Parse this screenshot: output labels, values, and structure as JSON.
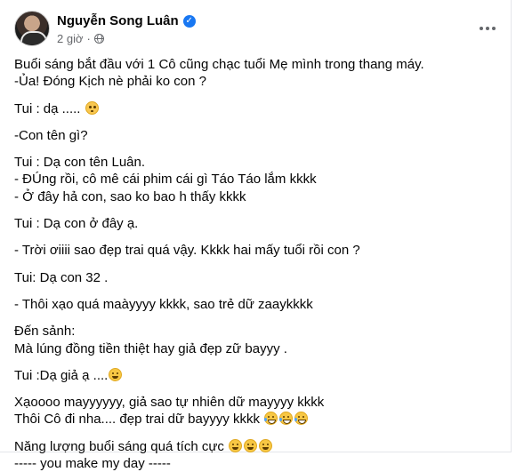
{
  "post": {
    "author_name": "Nguyễn Song Luân",
    "verified_glyph": "✓",
    "time": "2 giờ",
    "privacy_icon": "globe-icon",
    "more_icon": "more-options-icon"
  },
  "body": {
    "paragraphs": [
      [
        "Buổi sáng bắt đầu với 1 Cô cũng chạc tuổi Mẹ mình trong thang máy.",
        "-Ủa! Đóng Kịch nè phải ko con ?"
      ],
      [
        "Tui : dạ ....."
      ],
      [
        "-Con tên gì?"
      ],
      [
        "Tui : Dạ con tên Luân.",
        "- ĐÚng rồi, cô mê cái phim cái gì Táo Táo lắm kkkk",
        "- Ở đây hả con, sao ko bao h thấy kkkk"
      ],
      [
        "Tui : Dạ con ở đây ạ."
      ],
      [
        "- Trời ơiiii sao đẹp trai quá vậy. Kkkk hai mấy tuổi rồi con ?"
      ],
      [
        "Tui: Dạ con 32 ."
      ],
      [
        "- Thôi xạo quá maàyyyy kkkk, sao trẻ dữ zaaykkkk"
      ],
      [
        "Đến sảnh:",
        "Mà lúng đồng tiền thiệt hay giả đẹp zữ bayyy ."
      ],
      [
        "Tui :Dạ giả ạ ...."
      ],
      [
        "Xạoooo mayyyyyy, giả sao tự nhiên dữ mayyyy kkkk",
        "Thôi Cô đi nha.... đẹp trai dữ bayyyy kkkk"
      ],
      [
        "Năng lượng buổi sáng quá tích cực",
        "----- you make my day -----"
      ]
    ]
  }
}
